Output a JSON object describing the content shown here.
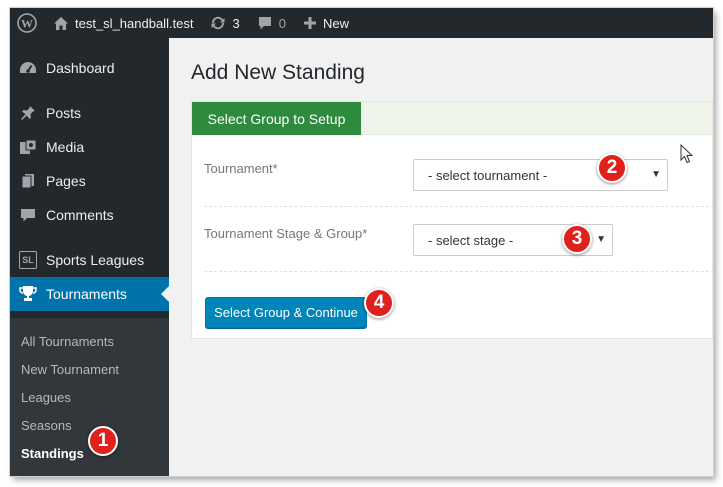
{
  "adminbar": {
    "site_name": "test_sl_handball.test",
    "updates_count": "3",
    "comments_count": "0",
    "new_label": "New"
  },
  "sidebar": {
    "menu": [
      {
        "label": "Dashboard",
        "icon": "dashboard-icon"
      },
      {
        "label": "Posts",
        "icon": "pin-icon"
      },
      {
        "label": "Media",
        "icon": "media-icon"
      },
      {
        "label": "Pages",
        "icon": "pages-icon"
      },
      {
        "label": "Comments",
        "icon": "comment-icon"
      },
      {
        "label": "Sports Leagues",
        "icon": "sl-icon",
        "badge": "SL"
      },
      {
        "label": "Tournaments",
        "icon": "trophy-icon",
        "active": true
      }
    ],
    "submenu": [
      {
        "label": "All Tournaments"
      },
      {
        "label": "New Tournament"
      },
      {
        "label": "Leagues"
      },
      {
        "label": "Seasons"
      },
      {
        "label": "Standings",
        "current": true
      }
    ]
  },
  "page": {
    "title": "Add New Standing",
    "tab_label": "Select Group to Setup",
    "fields": [
      {
        "label": "Tournament*",
        "value": "- select tournament -"
      },
      {
        "label": "Tournament Stage & Group*",
        "value": "- select stage -"
      }
    ],
    "submit_label": "Select Group & Continue"
  },
  "steps": [
    "1",
    "2",
    "3",
    "4"
  ],
  "colors": {
    "adminbar_bg": "#23282d",
    "active_menu": "#0073aa",
    "tab_green": "#2e8b3e",
    "button_blue": "#0085ba",
    "step_red": "#e0201d"
  }
}
